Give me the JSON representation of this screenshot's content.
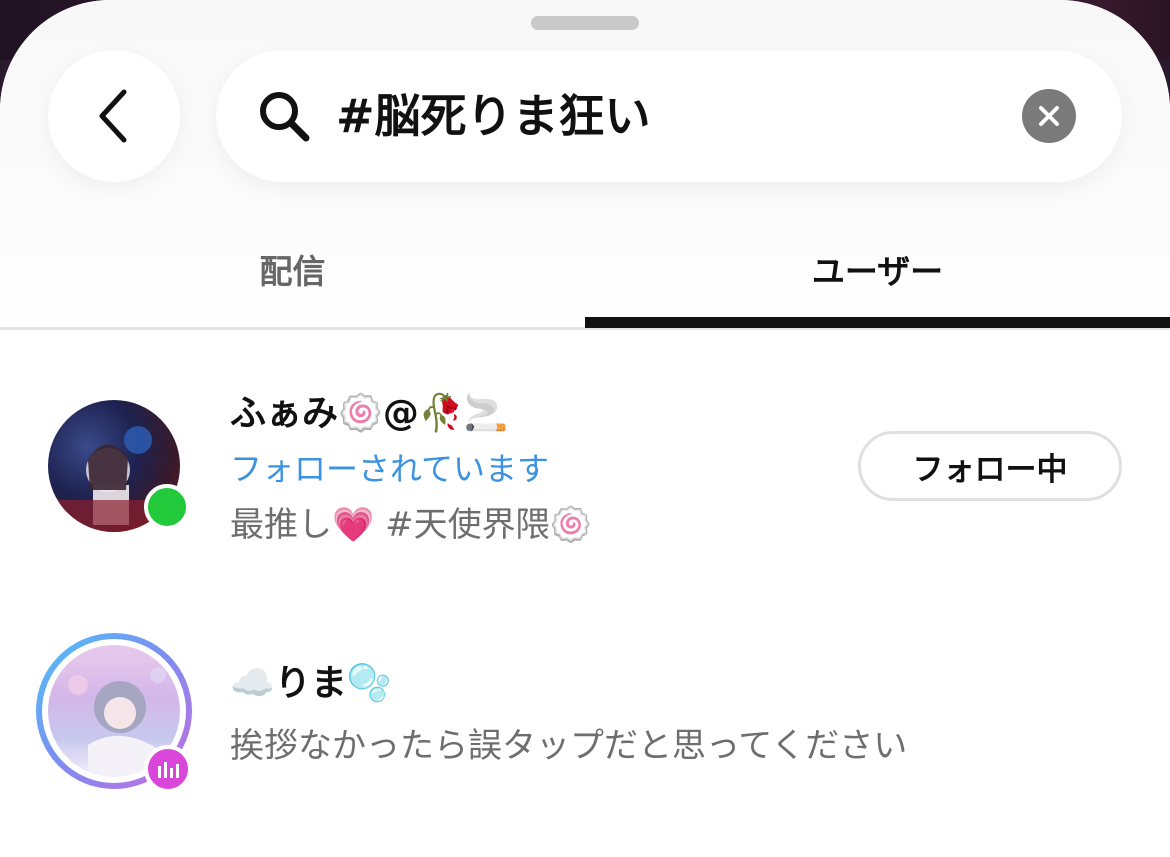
{
  "search": {
    "query": "#脳死りま狂い"
  },
  "tabs": [
    {
      "label": "配信",
      "active": false
    },
    {
      "label": "ユーザー",
      "active": true
    }
  ],
  "users": [
    {
      "name": "ふぁみ🍥@🥀🚬",
      "follow_status": "フォローされています",
      "bio": "最推し💗 #天使界隈🍥",
      "button_label": "フォロー中",
      "online": true
    },
    {
      "name": "☁️りま🫧",
      "bio": "挨拶なかったら誤タップだと思ってください",
      "live": true
    }
  ],
  "colors": {
    "accent_blue": "#3a92e0",
    "online_green": "#22c93a",
    "live_pink": "#d946d9",
    "tab_indicator": "#111111"
  },
  "icons": [
    "chevron-left-icon",
    "search-icon",
    "clear-icon",
    "live-audio-icon"
  ]
}
